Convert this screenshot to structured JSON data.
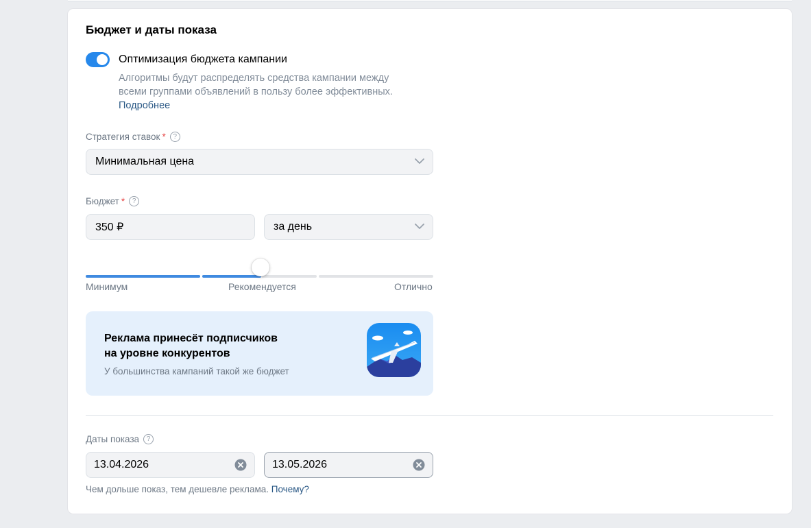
{
  "section": {
    "title": "Бюджет и даты показа"
  },
  "optimization": {
    "label": "Оптимизация бюджета кампании",
    "enabled": true,
    "description": "Алгоритмы будут распределять средства кампании между всеми группами объявлений в пользу более эффективных.",
    "link": "Подробнее"
  },
  "strategy": {
    "label": "Стратегия ставок",
    "required_mark": "*",
    "help_icon": "question-circle-icon",
    "value": "Минимальная цена"
  },
  "budget": {
    "label": "Бюджет",
    "required_mark": "*",
    "help_icon": "question-circle-icon",
    "amount": "350 ₽",
    "period": "за день"
  },
  "slider": {
    "level": 0.5,
    "labels": {
      "min": "Минимум",
      "recommended": "Рекомендуется",
      "excellent": "Отлично"
    }
  },
  "promo": {
    "title_line1": "Реклама принесёт подписчиков",
    "title_line2": "на уровне конкурентов",
    "subtitle": "У большинства кампаний такой же бюджет",
    "art_icon": "airplane-illustration"
  },
  "dates": {
    "label": "Даты показа",
    "help_icon": "question-circle-icon",
    "start": "13.04.2026",
    "end": "13.05.2026",
    "clear_icon": "clear-circle-icon",
    "hint": "Чем дольше показ, тем дешевле реклама.",
    "hint_link": "Почему?"
  },
  "colors": {
    "accent": "#2688eb",
    "link": "#2a5885",
    "promo_bg": "#e5f0fc",
    "required": "#e64646"
  }
}
